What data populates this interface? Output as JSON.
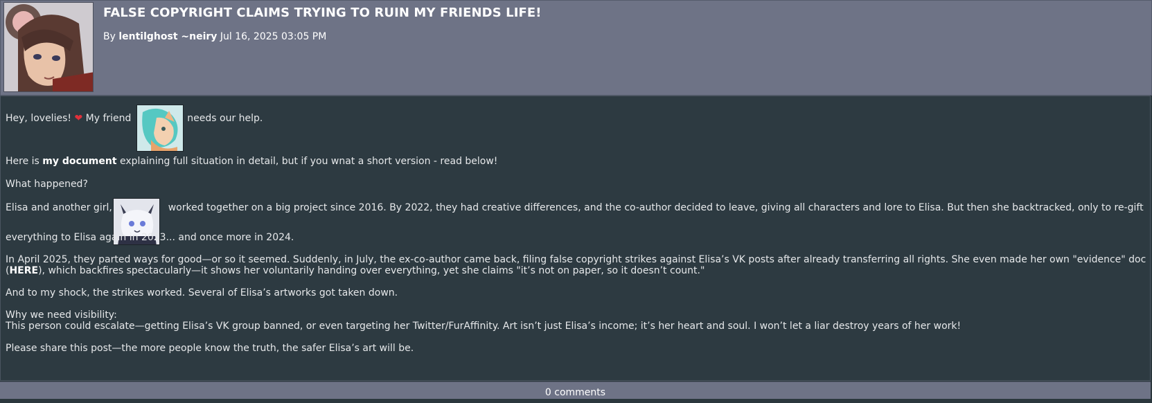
{
  "post": {
    "title": "FALSE COPYRIGHT CLAIMS TRYING TO RUIN MY FRIENDS LIFE!",
    "by_label": "By",
    "author": "lentilghost ~neiry",
    "date": "Jul 16, 2025 03:05 PM",
    "avatar_icon": "author-avatar",
    "body": {
      "greeting_a": "Hey, lovelies!",
      "heart_icon": "heart-icon",
      "greeting_b": "My friend",
      "greeting_c": "needs our help.",
      "doc_a": "Here is",
      "doc_link": "my document",
      "doc_b": "explaining full situation in detail, but if you wnat a short version - read below!",
      "what_happened": "What happened?",
      "p1_a": "Elisa and another girl,",
      "p1_b": "worked together on a big project since 2016. By 2022, they had creative differences, and the co-author decided to leave, giving all characters and lore to Elisa. But then she backtracked, only to re-gift",
      "p1_c": "everything to Elisa again in 2023... and once more in 2024.",
      "p2_a": "In April 2025, they parted ways for good—or so it seemed. Suddenly, in July, the ex-co-author came back, filing false copyright strikes against Elisa’s VK posts after already transferring all rights. She even made her own \"evidence\" doc",
      "p2_b_open": "(",
      "p2_here": "HERE",
      "p2_b_close": "), which backfires spectacularly—it shows her voluntarily handing over everything, yet she claims \"it’s not on paper, so it doesn’t count.\"",
      "p3": "And to my shock, the strikes worked. Several of Elisa’s artworks got taken down.",
      "p4_head": "Why we need visibility:",
      "p4": "This person could escalate—getting Elisa’s VK group banned, or even targeting her Twitter/FurAffinity. Art isn’t just Elisa’s income; it’s her heart and soul. I won’t let a liar destroy years of her work!",
      "p5": "Please share this post—the more people know the truth, the safer Elisa’s art will be."
    },
    "comments_label": "0 comments"
  },
  "colors": {
    "header_bg": "#6e7386",
    "body_bg": "#2d3a41",
    "heart": "#e0303a"
  }
}
